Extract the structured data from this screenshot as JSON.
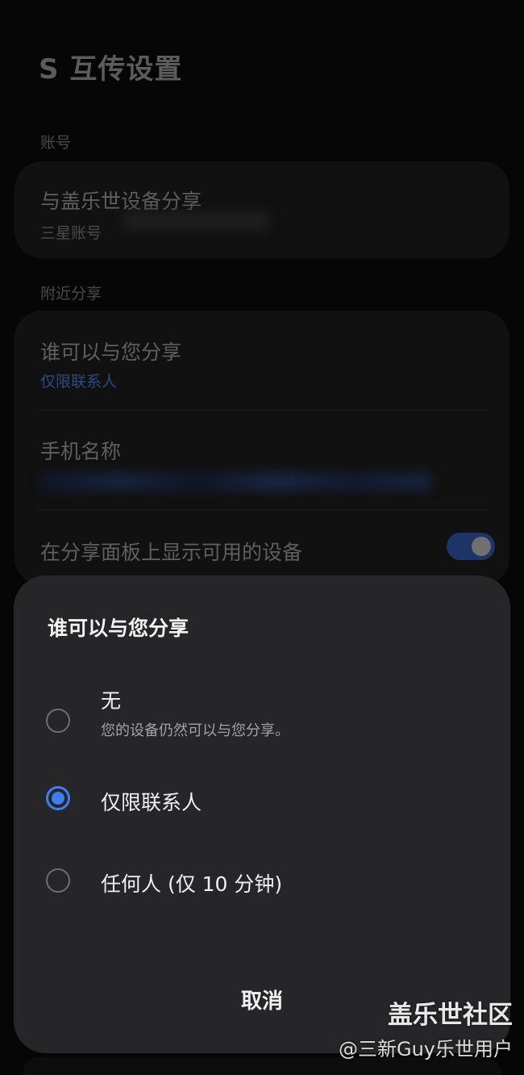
{
  "page": {
    "title": "S 互传设置"
  },
  "account_section": {
    "label": "账号",
    "share_row": {
      "title": "与盖乐世设备分享",
      "subtitle": "三星账号"
    }
  },
  "nearby_section": {
    "label": "附近分享",
    "who_row": {
      "title": "谁可以与您分享",
      "value": "仅限联系人"
    },
    "phone_name_row": {
      "title": "手机名称"
    },
    "show_devices_row": {
      "title": "在分享面板上显示可用的设备",
      "toggle_on": true
    }
  },
  "dialog": {
    "title": "谁可以与您分享",
    "options": [
      {
        "label": "无",
        "subtitle": "您的设备仍然可以与您分享。",
        "selected": false
      },
      {
        "label": "仅限联系人",
        "selected": true
      },
      {
        "label": "任何人 (仅 10 分钟)",
        "selected": false
      }
    ],
    "cancel_label": "取消"
  },
  "watermark": {
    "brand": "盖乐世社区",
    "user": "@三新Guy乐世用户"
  },
  "colors": {
    "accent": "#3f7ef0",
    "dialog_bg": "#262628"
  }
}
